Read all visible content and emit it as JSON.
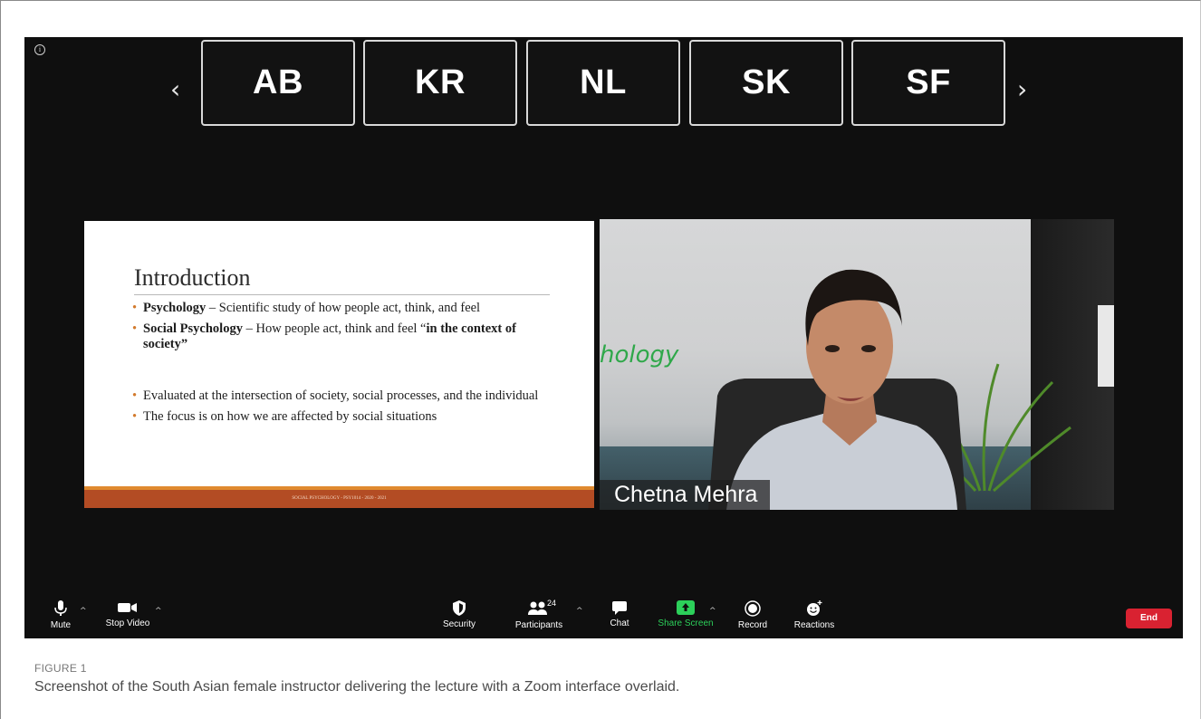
{
  "gallery": {
    "prev_arrow": "‹",
    "next_arrow": "›",
    "tiles": [
      "AB",
      "KR",
      "NL",
      "SK",
      "SF"
    ]
  },
  "info_icon": "i",
  "slide": {
    "title": "Introduction",
    "bullets": [
      {
        "bold": "Psychology",
        "text": " – Scientific study of how people act, think, and feel"
      },
      {
        "bold": "Social Psychology",
        "text": " – How people act, think and feel “",
        "bold2": "in the context of society”"
      },
      {
        "text": "Evaluated at the intersection of society, social processes, and the individual"
      },
      {
        "text": "The focus is on how we are affected by social situations"
      }
    ],
    "footer": "SOCIAL PSYCHOLOGY - PSY1014 - 2020 - 2021"
  },
  "video": {
    "participant_name": "Chetna Mehra",
    "handwriting": "hology"
  },
  "toolbar": {
    "mute": "Mute",
    "stop_video": "Stop Video",
    "security": "Security",
    "participants": "Participants",
    "participant_count": "24",
    "chat": "Chat",
    "share_screen": "Share Screen",
    "record": "Record",
    "reactions": "Reactions",
    "end": "End",
    "caret": "^"
  },
  "colors": {
    "share_green": "#2cd05a",
    "end_red": "#d92231",
    "slide_footer": "#b34c24",
    "bullet_accent": "#d27a2c"
  },
  "caption": {
    "label": "FIGURE 1",
    "text": "Screenshot of the South Asian female instructor delivering the lecture with a Zoom interface overlaid."
  }
}
